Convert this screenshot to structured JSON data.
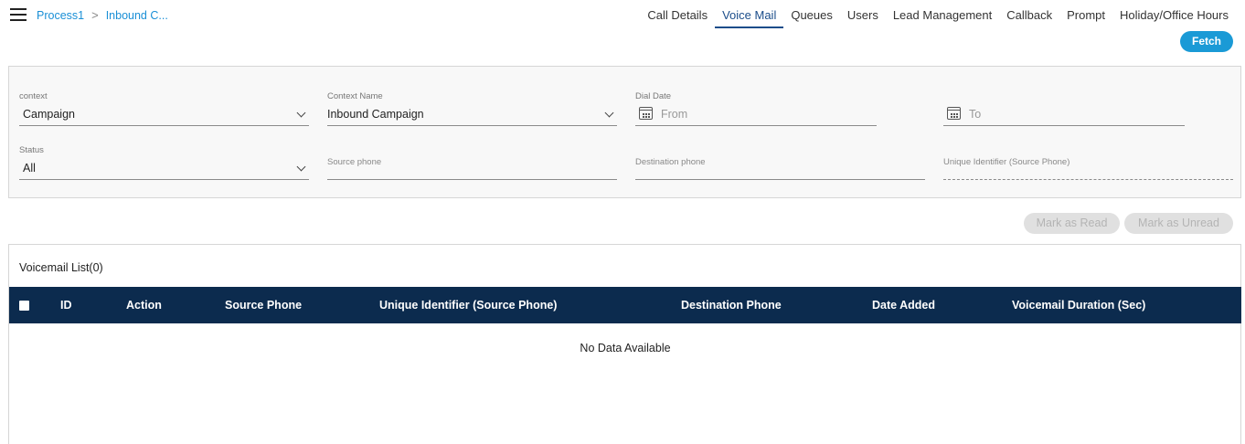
{
  "breadcrumb": {
    "items": [
      "Process1",
      "Inbound C..."
    ],
    "separator": ">"
  },
  "nav": {
    "items": [
      "Call Details",
      "Voice Mail",
      "Queues",
      "Users",
      "Lead Management",
      "Callback",
      "Prompt",
      "Holiday/Office Hours"
    ],
    "active": "Voice Mail"
  },
  "fetch_label": "Fetch",
  "filters": {
    "context": {
      "label": "context",
      "value": "Campaign"
    },
    "context_name": {
      "label": "Context Name",
      "value": "Inbound Campaign"
    },
    "dial_date": {
      "label": "Dial Date",
      "from_placeholder": "From",
      "to_placeholder": "To"
    },
    "status": {
      "label": "Status",
      "value": "All"
    },
    "source_phone": {
      "placeholder": "Source phone"
    },
    "destination_phone": {
      "placeholder": "Destination phone"
    },
    "unique_identifier": {
      "placeholder": "Unique Identifier (Source Phone)"
    }
  },
  "actions": {
    "mark_read": "Mark as Read",
    "mark_unread": "Mark as Unread"
  },
  "list": {
    "title": "Voicemail List(0)",
    "columns": [
      "ID",
      "Action",
      "Source Phone",
      "Unique Identifier (Source Phone)",
      "Destination Phone",
      "Date Added",
      "Voicemail Duration (Sec)"
    ],
    "empty_text": "No Data Available"
  },
  "colors": {
    "accent": "#1a9ad6",
    "link": "#1a8fd6",
    "header_bg": "#0c2b4e",
    "active_tab": "#1b4d8a",
    "disabled_btn": "#e0e0e0"
  },
  "icons": {
    "menu": "hamburger-menu-icon",
    "breadcrumb_sep": "chevron-right-icon",
    "dropdown": "chevron-down-icon",
    "date": "calendar-icon"
  }
}
